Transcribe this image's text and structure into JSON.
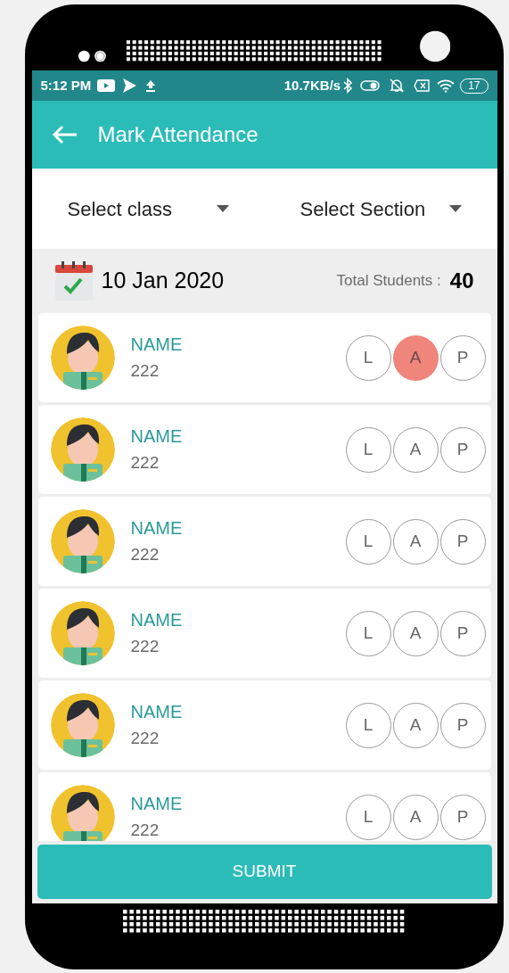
{
  "status_bar": {
    "time": "5:12 PM",
    "speed": "10.7KB/s",
    "battery": "17"
  },
  "app_bar": {
    "title": "Mark Attendance"
  },
  "filters": [
    {
      "label": "Select class"
    },
    {
      "label": "Select Section"
    }
  ],
  "summary": {
    "date": "10 Jan 2020",
    "total_label": "Total Students :",
    "total_value": "40"
  },
  "students": [
    {
      "name": "NAME",
      "id": "222",
      "options": [
        {
          "label": "L",
          "selected": false
        },
        {
          "label": "A",
          "selected": true
        },
        {
          "label": "P",
          "selected": false
        }
      ]
    },
    {
      "name": "NAME",
      "id": "222",
      "options": [
        {
          "label": "L",
          "selected": false
        },
        {
          "label": "A",
          "selected": false
        },
        {
          "label": "P",
          "selected": false
        }
      ]
    },
    {
      "name": "NAME",
      "id": "222",
      "options": [
        {
          "label": "L",
          "selected": false
        },
        {
          "label": "A",
          "selected": false
        },
        {
          "label": "P",
          "selected": false
        }
      ]
    },
    {
      "name": "NAME",
      "id": "222",
      "options": [
        {
          "label": "L",
          "selected": false
        },
        {
          "label": "A",
          "selected": false
        },
        {
          "label": "P",
          "selected": false
        }
      ]
    },
    {
      "name": "NAME",
      "id": "222",
      "options": [
        {
          "label": "L",
          "selected": false
        },
        {
          "label": "A",
          "selected": false
        },
        {
          "label": "P",
          "selected": false
        }
      ]
    },
    {
      "name": "NAME",
      "id": "222",
      "options": [
        {
          "label": "L",
          "selected": false
        },
        {
          "label": "A",
          "selected": false
        },
        {
          "label": "P",
          "selected": false
        }
      ]
    }
  ],
  "submit": "SUBMIT"
}
